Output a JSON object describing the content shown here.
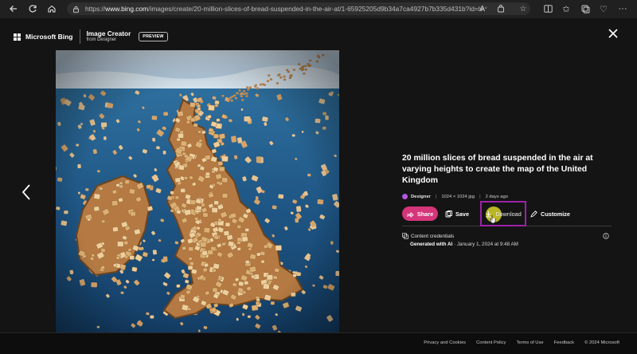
{
  "browser": {
    "url_prefix": "https://",
    "url_host": "www.bing.com",
    "url_rest": "/images/create/20-million-slices-of-bread-suspended-in-the-air-at/1-65925205d9b34a7ca4927b7b335d431b?id=lvtK..."
  },
  "header": {
    "brand": "Microsoft Bing",
    "product_title": "Image Creator",
    "product_subtitle": "from Designer",
    "preview_badge": "PREVIEW"
  },
  "image": {
    "title": "20 million slices of bread suspended in the air at varying heights to create the map of the United Kingdom",
    "source": "Designer",
    "dimensions": "1024 × 1024 jpg",
    "age": "2 days ago"
  },
  "actions": {
    "share": "Share",
    "save": "Save",
    "download": "Download",
    "customize": "Customize"
  },
  "credentials": {
    "label": "Content credentials",
    "generated_bold": "Generated with AI",
    "generated_rest": " · January 1, 2024 at 9:48 AM"
  },
  "footer": {
    "links": [
      "Privacy and Cookies",
      "Content Policy",
      "Terms of Use",
      "Feedback",
      "© 2024 Microsoft"
    ]
  },
  "colors": {
    "share_button": "#d5357a",
    "download_highlight": "#9b23a8",
    "cursor_highlight": "#d7d228"
  }
}
